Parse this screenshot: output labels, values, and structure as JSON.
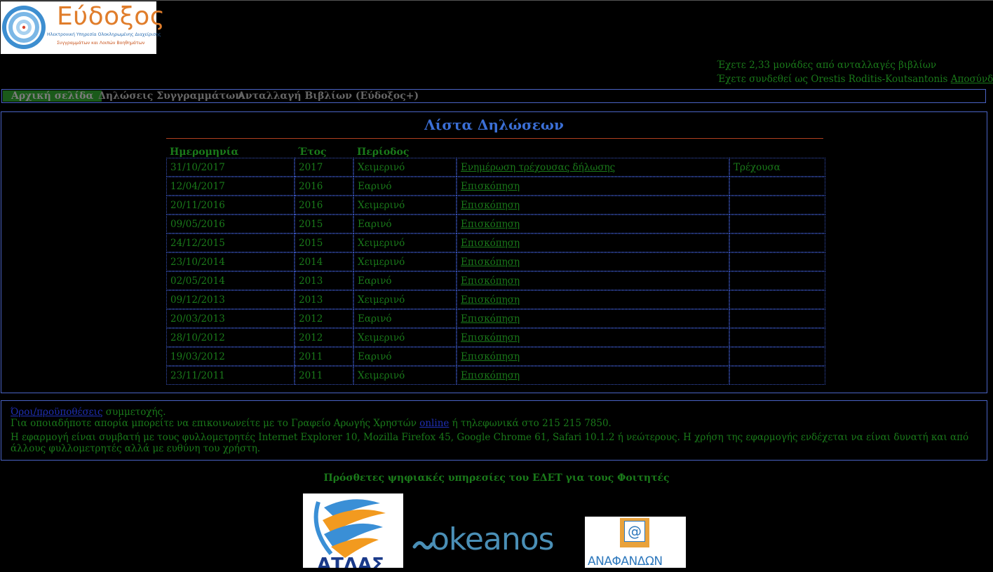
{
  "logo": {
    "title": "Εύδοξος",
    "subtitle_line1": "Ηλεκτρονική Υπηρεσία Ολοκληρωμένης Διαχείρισης",
    "subtitle_line2": "Συγγραμμάτων και Λοιπών Βοηθημάτων"
  },
  "user": {
    "credits_text": "Έχετε 2,33 μονάδες από ανταλλαγές βιβλίων",
    "logged_in_text": "Έχετε συνδεθεί ως Orestis Roditis-Koutsantonis",
    "logout_label": "Αποσύνδεση"
  },
  "nav": {
    "items": [
      {
        "label": "Αρχική σελίδα"
      },
      {
        "label": "Δηλώσεις Συγγραμμάτων"
      },
      {
        "label": "Ανταλλαγή Βιβλίων (Εύδοξος+)"
      }
    ]
  },
  "declarations": {
    "title": "Λίστα Δηλώσεων",
    "headers": [
      "Ημερομηνία",
      "Έτος",
      "Περίοδος",
      "",
      ""
    ],
    "rows": [
      {
        "date": "31/10/2017",
        "year": "2017",
        "period": "Χειμερινό",
        "action": "Ενημέρωση τρέχουσας δήλωσης",
        "status": "Τρέχουσα"
      },
      {
        "date": "12/04/2017",
        "year": "2016",
        "period": "Εαρινό",
        "action": "Επισκόπηση",
        "status": ""
      },
      {
        "date": "20/11/2016",
        "year": "2016",
        "period": "Χειμερινό",
        "action": "Επισκόπηση",
        "status": ""
      },
      {
        "date": "09/05/2016",
        "year": "2015",
        "period": "Εαρινό",
        "action": "Επισκόπηση",
        "status": ""
      },
      {
        "date": "24/12/2015",
        "year": "2015",
        "period": "Χειμερινό",
        "action": "Επισκόπηση",
        "status": ""
      },
      {
        "date": "23/10/2014",
        "year": "2014",
        "period": "Χειμερινό",
        "action": "Επισκόπηση",
        "status": ""
      },
      {
        "date": "02/05/2014",
        "year": "2013",
        "period": "Εαρινό",
        "action": "Επισκόπηση",
        "status": ""
      },
      {
        "date": "09/12/2013",
        "year": "2013",
        "period": "Χειμερινό",
        "action": "Επισκόπηση",
        "status": ""
      },
      {
        "date": "20/03/2013",
        "year": "2012",
        "period": "Εαρινό",
        "action": "Επισκόπηση",
        "status": ""
      },
      {
        "date": "28/10/2012",
        "year": "2012",
        "period": "Χειμερινό",
        "action": "Επισκόπηση",
        "status": ""
      },
      {
        "date": "19/03/2012",
        "year": "2011",
        "period": "Εαρινό",
        "action": "Επισκόπηση",
        "status": ""
      },
      {
        "date": "23/11/2011",
        "year": "2011",
        "period": "Χειμερινό",
        "action": "Επισκόπηση",
        "status": ""
      }
    ]
  },
  "info": {
    "terms_link": "Όροι/προϋποθέσεις",
    "terms_suffix": " συμμετοχής.",
    "help_prefix": "Για οποιαδήποτε απορία μπορείτε να επικοινωνείτε με το Γραφείο Αρωγής Χρηστών ",
    "help_link": "online",
    "help_suffix": " ή τηλεφωνικά στο 215 215 7850.",
    "compat_text": "Η εφαρμογή είναι συμβατή με τους φυλλομετρητές Internet Explorer 10, Mozilla Firefox 45, Google Chrome 61, Safari 10.1.2 ή νεώτερους. Η χρήση της εφαρμογής ενδέχεται να είναι δυνατή και από άλλους φυλλομετρητές αλλά με ευθύνη του χρήστη."
  },
  "extras": {
    "title": "Πρόσθετες ψηφιακές υπηρεσίες του ΕΔΕΤ για τους Φοιτητές",
    "logos": [
      {
        "name": "ΑΤΛΑΣ",
        "icon": "atlas-logo"
      },
      {
        "name": "okeanos",
        "icon": "okeanos-logo"
      },
      {
        "name": "ΑΝΑΦΑΝΔΩΝ",
        "icon": "anafandon-logo"
      }
    ]
  },
  "colors": {
    "background": "#000000",
    "text_green": "#1a7a1a",
    "border_blue": "#4a63c4",
    "title_blue": "#3b6fd6",
    "logo_orange": "#e07d2b"
  }
}
